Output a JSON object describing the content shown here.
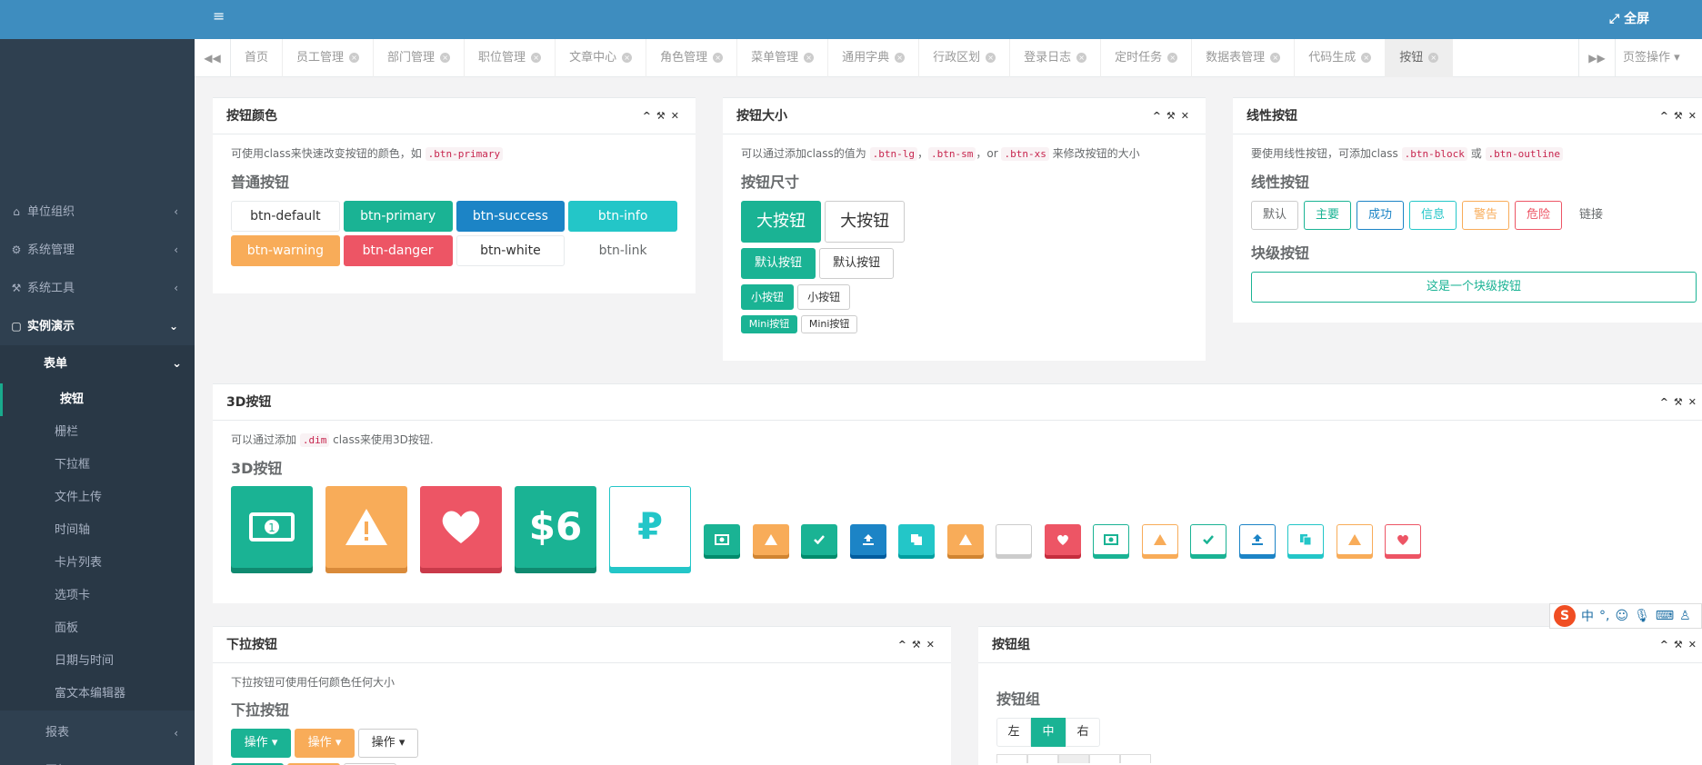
{
  "topbar": {
    "menu_icon": "≡",
    "fullscreen_label": "全屏"
  },
  "tabs": {
    "items": [
      "首页",
      "员工管理",
      "部门管理",
      "职位管理",
      "文章中心",
      "角色管理",
      "菜单管理",
      "通用字典",
      "行政区划",
      "登录日志",
      "定时任务",
      "数据表管理",
      "代码生成",
      "按钮"
    ],
    "active": "按钮",
    "ops_label": "页签操作"
  },
  "sidebar": {
    "menus": [
      {
        "label": "单位组织",
        "icon": "home-icon"
      },
      {
        "label": "系统管理",
        "icon": "gear-icon"
      },
      {
        "label": "系统工具",
        "icon": "tools-icon"
      },
      {
        "label": "实例演示",
        "icon": "square-icon"
      }
    ],
    "group": "表单",
    "sub_items": [
      "按钮",
      "栅栏",
      "下拉框",
      "文件上传",
      "时间轴",
      "卡片列表",
      "选项卡",
      "面板",
      "日期与时间",
      "富文本编辑器"
    ],
    "bottom_menus": [
      "报表",
      "图标"
    ]
  },
  "panels": {
    "colors": {
      "title": "按钮颜色",
      "desc_prefix": "可使用class来快速改变按钮的颜色，如",
      "desc_code": ".btn-primary",
      "heading": "普通按钮",
      "row1": [
        "btn-default",
        "btn-primary",
        "btn-success",
        "btn-info"
      ],
      "row2": [
        "btn-warning",
        "btn-danger",
        "btn-white",
        "btn-link"
      ]
    },
    "sizes": {
      "title": "按钮大小",
      "desc_prefix": "可以通过添加class的值为",
      "code1": ".btn-lg",
      "sep1": "，",
      "code2": ".btn-sm",
      "sep2": "，or",
      "code3": ".btn-xs",
      "desc_suffix": "来修改按钮的大小",
      "heading": "按钮尺寸",
      "large": [
        "大按钮",
        "大按钮"
      ],
      "default": [
        "默认按钮",
        "默认按钮"
      ],
      "small": [
        "小按钮",
        "小按钮"
      ],
      "mini": [
        "Mini按钮",
        "Mini按钮"
      ]
    },
    "outline": {
      "title": "线性按钮",
      "desc_prefix": "要使用线性按钮，可添加class",
      "code1": ".btn-block",
      "sep": "或",
      "code2": ".btn-outline",
      "heading": "线性按钮",
      "buttons": [
        "默认",
        "主要",
        "成功",
        "信息",
        "警告",
        "危险",
        "链接"
      ],
      "block_heading": "块级按钮",
      "block_button": "这是一个块级按钮"
    },
    "d3": {
      "title": "3D按钮",
      "desc_prefix": "可以通过添加",
      "desc_code": ".dim",
      "desc_suffix": "class来使用3D按钮.",
      "heading": "3D按钮",
      "dollar_label": "$6",
      "ruble_label": "₽"
    },
    "dropdown": {
      "title": "下拉按钮",
      "desc": "下拉按钮可使用任何颜色任何大小",
      "heading": "下拉按钮",
      "buttons": [
        "操作",
        "操作",
        "操作"
      ]
    },
    "group": {
      "title": "按钮组",
      "heading": "按钮组",
      "buttons": [
        "左",
        "中",
        "右"
      ]
    }
  },
  "ime": {
    "label": "中"
  },
  "colors": {
    "primary": "#1ab394",
    "success": "#1c84c6",
    "info": "#23c6c8",
    "warning": "#f8ac59",
    "danger": "#ed5565",
    "sidebar": "#2f4050",
    "topbar": "#3e8dbf"
  }
}
